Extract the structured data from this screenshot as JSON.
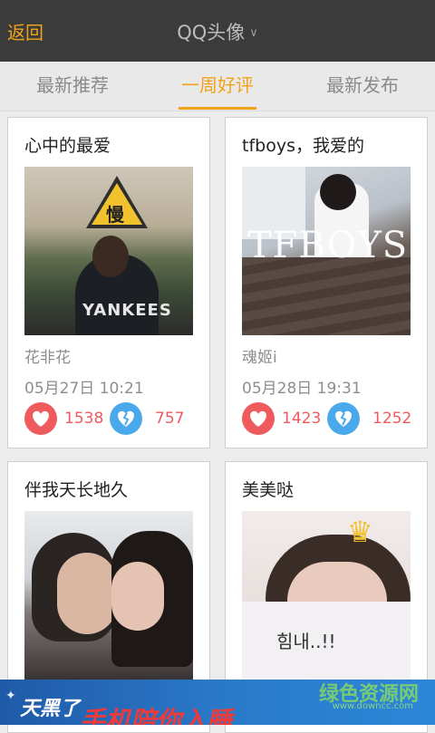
{
  "header": {
    "back_label": "返回",
    "title": "QQ头像"
  },
  "tabs": [
    {
      "label": "最新推荐",
      "active": false
    },
    {
      "label": "一周好评",
      "active": true
    },
    {
      "label": "最新发布",
      "active": false
    }
  ],
  "cards": [
    {
      "title": "心中的最爱",
      "author": "花非花",
      "time": "05月27日 10:21",
      "likes": "1538",
      "dislikes": "757",
      "photo_text": "慢",
      "photo_text2": "YANKEES"
    },
    {
      "title": "tfboys，我爱的",
      "author": "魂姬i",
      "time": "05月28日 19:31",
      "likes": "1423",
      "dislikes": "1252",
      "photo_text": "TFBOYS"
    },
    {
      "title": "伴我天长地久"
    },
    {
      "title": "美美哒",
      "photo_text": "힘내..!!"
    }
  ],
  "ad": {
    "text1": "天黑了",
    "text2": "手机陪你入睡"
  },
  "watermark": {
    "text": "绿色资源网",
    "url": "www.downcc.com"
  },
  "colors": {
    "accent": "#f0a31a",
    "header_bg": "#3b3b3b",
    "like": "#ef5a5d",
    "dislike": "#49a9ea"
  }
}
